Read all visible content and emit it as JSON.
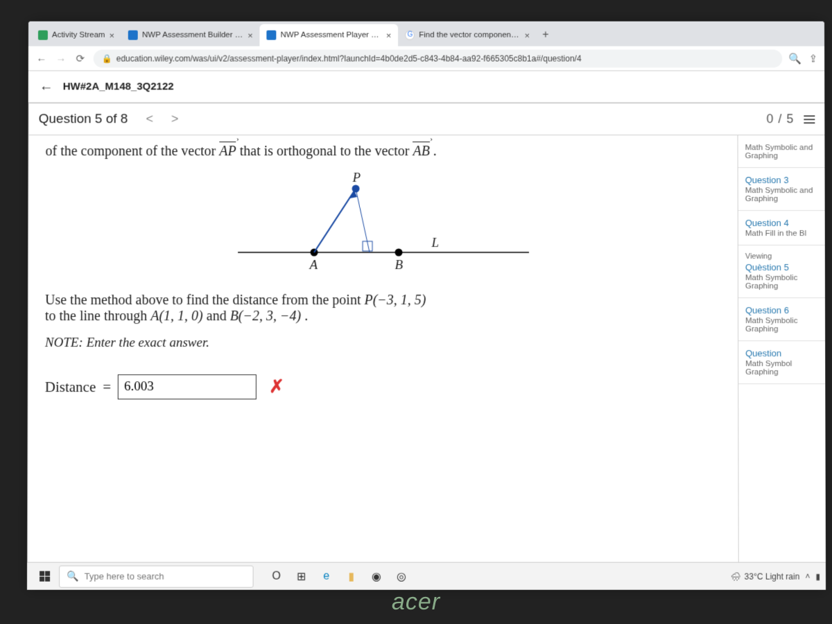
{
  "browser": {
    "tabs": [
      {
        "label": "Activity Stream",
        "favicon_color": "#2e9e5b"
      },
      {
        "label": "NWP Assessment Builder UI App",
        "favicon_color": "#1e73c9"
      },
      {
        "label": "NWP Assessment Player UI Appli",
        "favicon_color": "#1e73c9"
      },
      {
        "label": "Find the vector component of a",
        "favicon_color": "#ffffff"
      }
    ],
    "active_tab_index": 2,
    "url": "education.wiley.com/was/ui/v2/assessment-player/index.html?launchId=4b0de2d5-c843-4b84-aa92-f665305c8b1a#/question/4"
  },
  "assignment": {
    "back_label": "←",
    "name": "HW#2A_M148_3Q2122"
  },
  "question": {
    "label": "Question 5 of 8",
    "score": "0 / 5",
    "text_line1_prefix": "of the component of the vector ",
    "vector1": "AP",
    "text_line1_mid": " that is orthogonal to the vector ",
    "vector2": "AB",
    "text_line1_suffix": ".",
    "figure_labels": {
      "P": "P",
      "A": "A",
      "B": "B",
      "L": "L"
    },
    "para2_a": "Use the method above to find the distance from the point ",
    "pointP": "P(−3, 1, 5)",
    "para2_b": " to the line through ",
    "pointA": "A(1, 1, 0)",
    "para2_c": " and ",
    "pointB": "B(−2, 3, −4)",
    "para2_d": ".",
    "note": "NOTE: Enter the exact answer.",
    "answer_label": "Distance",
    "answer_value": "6.003",
    "answer_wrong_mark": "✗"
  },
  "sidebar": {
    "items": [
      {
        "title": "",
        "sub": "Math Symbolic and Graphing",
        "class": "cut"
      },
      {
        "title": "Question 3",
        "sub": "Math Symbolic and Graphing",
        "title_class": "blue"
      },
      {
        "title": "Question 4",
        "sub": "Math Fill in the Bl",
        "title_class": "blue"
      },
      {
        "pre": "Viewing",
        "title": "Quèstion 5",
        "sub": "Math Symbolic Graphing",
        "title_class": "blue",
        "current": true
      },
      {
        "title": "Question 6",
        "sub": "Math Symbolic Graphing",
        "title_class": "blue"
      },
      {
        "title": "Question",
        "sub": "Math Symbol Graphing",
        "title_class": "blue"
      }
    ]
  },
  "taskbar": {
    "search_placeholder": "Type here to search",
    "weather": "33°C  Light rain"
  },
  "brand": "acer"
}
